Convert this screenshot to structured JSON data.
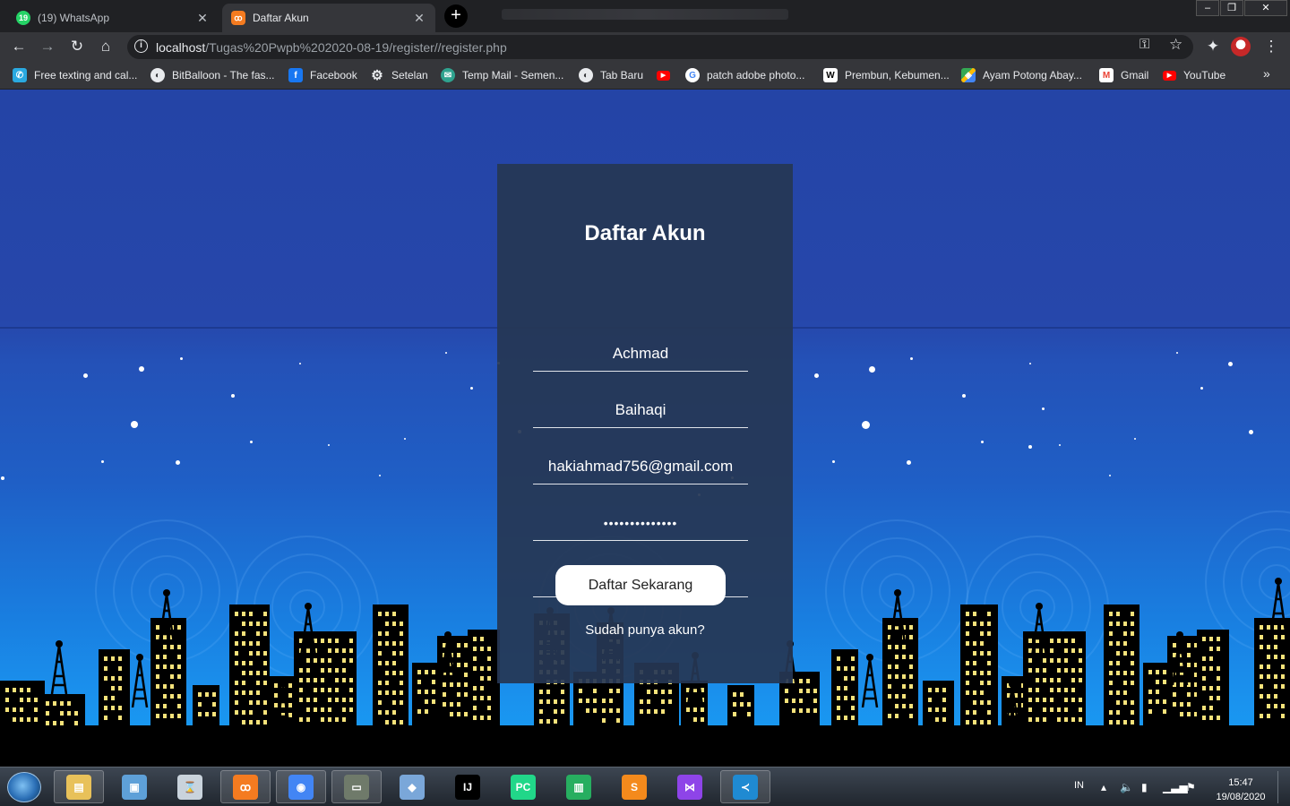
{
  "browser": {
    "tabs": [
      {
        "title": "(19) WhatsApp",
        "favicon": "whatsapp-icon",
        "badge": "19",
        "active": false
      },
      {
        "title": "Daftar Akun",
        "favicon": "xampp-icon",
        "active": true
      }
    ],
    "url_host": "localhost",
    "url_path": "/Tugas%20Pwpb%202020-08-19/register//register.php",
    "bookmarks": [
      {
        "label": "Free texting and cal...",
        "icon": "textfree-icon",
        "color": "#2aa9e0"
      },
      {
        "label": "BitBalloon - The fas...",
        "icon": "globe-icon",
        "color": "#5f6368"
      },
      {
        "label": "Facebook",
        "icon": "facebook-icon",
        "color": "#1877f2"
      },
      {
        "label": "Setelan",
        "icon": "gear-icon",
        "color": "#5f6368"
      },
      {
        "label": "Temp Mail - Semen...",
        "icon": "tempmail-icon",
        "color": "#2fa38f"
      },
      {
        "label": "Tab Baru",
        "icon": "globe-icon",
        "color": "#5f6368"
      },
      {
        "label": "",
        "icon": "youtube-icon",
        "color": "#ff0000"
      },
      {
        "label": "patch adobe photo...",
        "icon": "google-icon",
        "color": "#ffffff"
      },
      {
        "label": "Prembun, Kebumen...",
        "icon": "wikipedia-icon",
        "color": "#ffffff"
      },
      {
        "label": "Ayam Potong Abay...",
        "icon": "maps-icon",
        "color": "#34a853"
      },
      {
        "label": "Gmail",
        "icon": "gmail-icon",
        "color": "#ffffff"
      },
      {
        "label": "YouTube",
        "icon": "youtube-icon",
        "color": "#ff0000"
      }
    ],
    "bookmarks_more": "»"
  },
  "form": {
    "title": "Daftar Akun",
    "first_name": "Achmad",
    "last_name": "Baihaqi",
    "email": "hakiahmad756@gmail.com",
    "password": "••••••••••••••",
    "password_confirm": "••••••••••••••",
    "submit_label": "Daftar Sekarang",
    "login_link": "Sudah punya akun?"
  },
  "taskbar": {
    "apps": [
      {
        "name": "file-explorer-icon",
        "glyph": "▤",
        "color": "#e8c15a",
        "active": true
      },
      {
        "name": "photo-viewer-icon",
        "glyph": "▣",
        "color": "#5ea0d8",
        "active": false
      },
      {
        "name": "hourglass-icon",
        "glyph": "⌛",
        "color": "#c9d3dc",
        "active": false
      },
      {
        "name": "xampp-icon",
        "glyph": "ꝏ",
        "color": "#f47b20",
        "active": true
      },
      {
        "name": "chrome-icon",
        "glyph": "◉",
        "color": "#4285f4",
        "active": true
      },
      {
        "name": "terminal-icon",
        "glyph": "▭",
        "color": "#6f7a6a",
        "active": true
      },
      {
        "name": "virtualbox-icon",
        "glyph": "◆",
        "color": "#7aa7d9",
        "active": false
      },
      {
        "name": "intellij-icon",
        "glyph": "IJ",
        "color": "#000000",
        "active": false
      },
      {
        "name": "pycharm-icon",
        "glyph": "PC",
        "color": "#21d789",
        "active": false
      },
      {
        "name": "trello-icon",
        "glyph": "▥",
        "color": "#27ae60",
        "active": false
      },
      {
        "name": "sublime-icon",
        "glyph": "S",
        "color": "#f48a1c",
        "active": false
      },
      {
        "name": "visual-studio-icon",
        "glyph": "⋈",
        "color": "#8e44e8",
        "active": false
      },
      {
        "name": "vscode-icon",
        "glyph": "≺",
        "color": "#1f8ad2",
        "active": true
      }
    ],
    "language": "IN",
    "time": "15:47",
    "date": "19/08/2020"
  }
}
